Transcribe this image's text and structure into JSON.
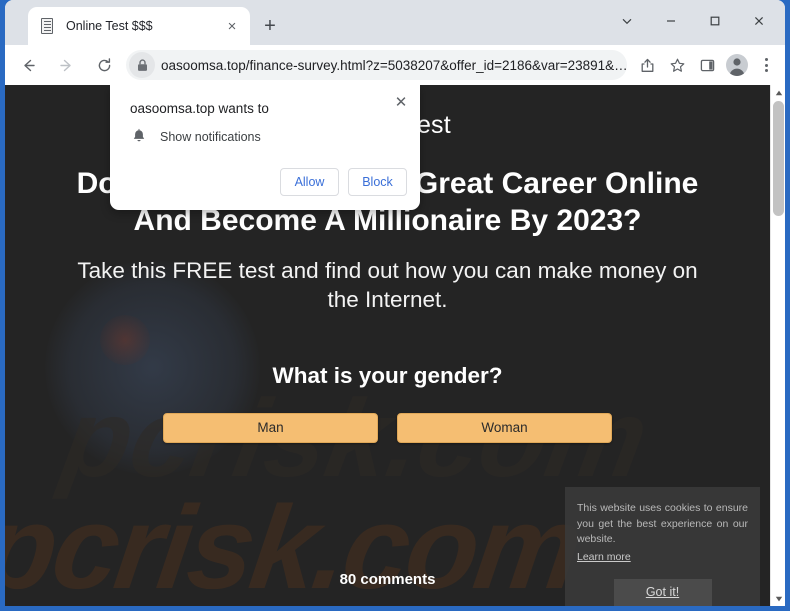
{
  "browser": {
    "tab": {
      "title": "Online Test $$$",
      "favicon": "document-icon",
      "close_label": "×"
    },
    "new_tab_label": "+",
    "window_controls": {
      "tab_search": "chevron-down-icon",
      "minimize": "minimize-icon",
      "maximize": "maximize-icon",
      "close": "close-icon"
    },
    "nav": {
      "back": "back-arrow-icon",
      "forward": "forward-arrow-icon",
      "reload": "reload-icon"
    },
    "omnibox": {
      "lock": "lock-icon",
      "url": "oasoomsa.top/finance-survey.html?z=5038207&offer_id=2186&var=23891&…"
    },
    "toolbar_icons": {
      "share": "share-icon",
      "bookmark": "star-icon",
      "side_panel": "side-panel-icon",
      "profile": "profile-avatar-icon",
      "menu": "three-dot-menu-icon"
    }
  },
  "permission_dialog": {
    "title": "oasoomsa.top wants to",
    "icon": "bell-icon",
    "request": "Show notifications",
    "allow_label": "Allow",
    "block_label": "Block",
    "close_label": "✕"
  },
  "page": {
    "site_title": "Online Test",
    "headline": "Do You Want To Start A Great Career Online And Become A Millionaire By 2023?",
    "subheadline": "Take this FREE test and find out how you can make money on the Internet.",
    "question": "What is your gender?",
    "answers": [
      {
        "label": "Man"
      },
      {
        "label": "Woman"
      }
    ],
    "comments": "80 comments",
    "watermark": "pcrisk.com",
    "colors": {
      "background": "#242424",
      "answer_button": "#f5be72",
      "answer_text": "#2b2b2b",
      "text": "#ffffff",
      "watermark": "#3a2b20",
      "window_frame": "#2a6ac2"
    }
  },
  "cookie_banner": {
    "text": "This website uses cookies to ensure you get the best experience on our website.",
    "learn_more": "Learn more",
    "accept_label": "Got it!"
  },
  "scrollbar": {
    "up_arrow": "▲",
    "down_arrow": "▼"
  }
}
